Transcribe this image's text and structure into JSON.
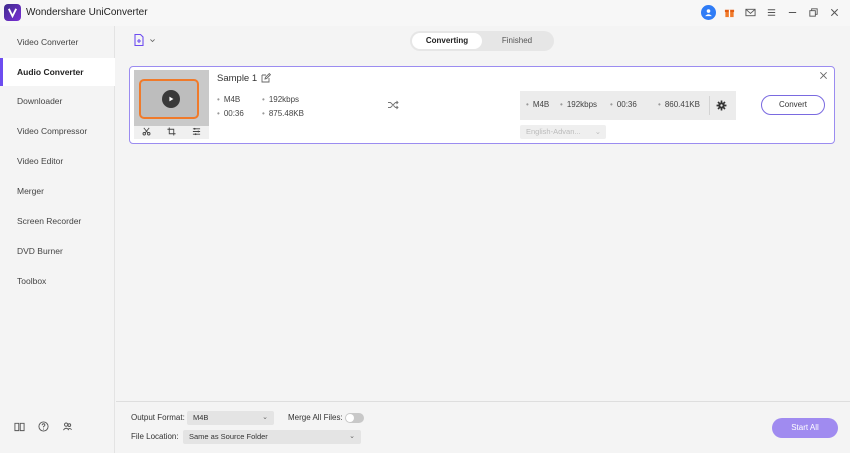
{
  "app": {
    "title": "Wondershare UniConverter"
  },
  "sidebar": {
    "items": [
      {
        "label": "Video Converter"
      },
      {
        "label": "Audio Converter",
        "active": true
      },
      {
        "label": "Downloader"
      },
      {
        "label": "Video Compressor"
      },
      {
        "label": "Video Editor"
      },
      {
        "label": "Merger"
      },
      {
        "label": "Screen Recorder"
      },
      {
        "label": "DVD Burner"
      },
      {
        "label": "Toolbox"
      }
    ]
  },
  "tabs": {
    "converting": "Converting",
    "finished": "Finished",
    "active": "Converting"
  },
  "file": {
    "name": "Sample 1",
    "source": {
      "format": "M4B",
      "bitrate": "192kbps",
      "duration": "00:36",
      "size": "875.48KB"
    },
    "target": {
      "format": "M4B",
      "bitrate": "192kbps",
      "duration": "00:36",
      "size": "860.41KB"
    },
    "subtitle_select": "English-Advan...",
    "convert_label": "Convert"
  },
  "footer": {
    "output_format_label": "Output Format:",
    "output_format_value": "M4B",
    "merge_label": "Merge All Files:",
    "merge_enabled": false,
    "file_location_label": "File Location:",
    "file_location_value": "Same as Source Folder",
    "start_all_label": "Start All"
  },
  "colors": {
    "accent": "#6d4df0",
    "highlight": "#f07a2a",
    "start_button": "#a08bf0",
    "avatar": "#2f7cf6"
  }
}
